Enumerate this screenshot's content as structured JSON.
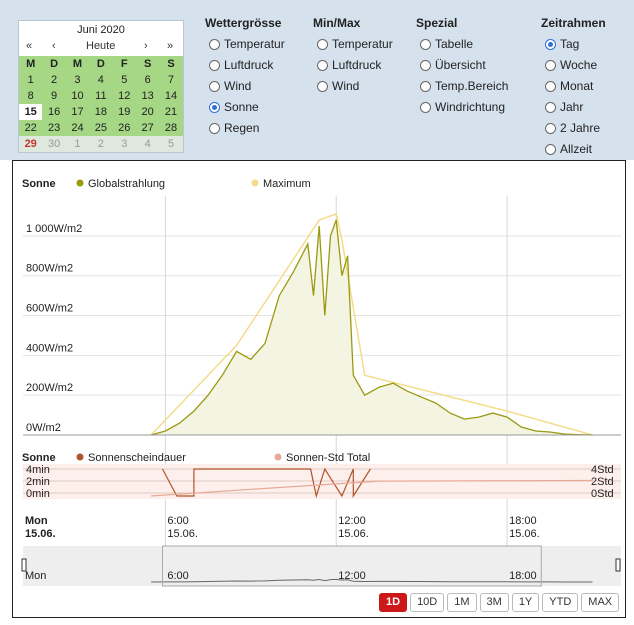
{
  "calendar": {
    "month": "Juni 2020",
    "nav": [
      "«",
      "‹",
      "Heute",
      "›",
      "»"
    ],
    "weekdays": [
      "M",
      "D",
      "M",
      "D",
      "F",
      "S",
      "S"
    ],
    "weeks": [
      [
        "1",
        "2",
        "3",
        "4",
        "5",
        "6",
        "7"
      ],
      [
        "8",
        "9",
        "10",
        "11",
        "12",
        "13",
        "14"
      ],
      [
        "15",
        "16",
        "17",
        "18",
        "19",
        "20",
        "21"
      ],
      [
        "22",
        "23",
        "24",
        "25",
        "26",
        "27",
        "28"
      ],
      [
        "29",
        "30",
        "1",
        "2",
        "3",
        "4",
        "5"
      ]
    ]
  },
  "groups": [
    {
      "title": "Wettergrösse",
      "options": [
        "Temperatur",
        "Luftdruck",
        "Wind",
        "Sonne",
        "Regen"
      ],
      "selected": 3
    },
    {
      "title": "Min/Max",
      "options": [
        "Temperatur",
        "Luftdruck",
        "Wind"
      ],
      "selected": -1
    },
    {
      "title": "Spezial",
      "options": [
        "Tabelle",
        "Übersicht",
        "Temp.Bereich",
        "Windrichtung"
      ],
      "selected": -1
    },
    {
      "title": "Zeitrahmen",
      "options": [
        "Tag",
        "Woche",
        "Monat",
        "Jahr",
        "2 Jahre",
        "Allzeit"
      ],
      "selected": 0
    }
  ],
  "chart_top": {
    "title": "Sonne",
    "legend": [
      "Globalstrahlung",
      "Maximum"
    ],
    "colors": {
      "global": "#9a9a10",
      "max": "#f3dc8a",
      "fill": "#f4f4e2"
    },
    "y_ticks": [
      "0W/m2",
      "200W/m2",
      "400W/m2",
      "600W/m2",
      "800W/m2",
      "1 000W/m2"
    ]
  },
  "chart_bottom": {
    "title": "Sonne",
    "legend": [
      "Sonnenscheindauer",
      "Sonnen-Std Total"
    ],
    "colors": {
      "duration": "#b0532a",
      "total": "#e7a996"
    },
    "left_ticks": [
      "4min",
      "2min",
      "0min"
    ],
    "right_ticks": [
      "4Std",
      "2Std",
      "0Std"
    ]
  },
  "x_axis": {
    "day_label": [
      "Mon",
      "15.06."
    ],
    "ticks": [
      [
        "6:00",
        "15.06."
      ],
      [
        "12:00",
        "15.06."
      ],
      [
        "18:00",
        "15.06."
      ]
    ]
  },
  "navigator": {
    "labels": [
      "Mon",
      "6:00",
      "12:00",
      "18:00"
    ]
  },
  "range_buttons": [
    "1D",
    "10D",
    "1M",
    "3M",
    "1Y",
    "YTD",
    "MAX"
  ],
  "chart_data": {
    "type": "area",
    "x_unit": "hour",
    "series": [
      {
        "name": "Globalstrahlung",
        "x": [
          5.5,
          6,
          6.5,
          7,
          7.5,
          8,
          8.5,
          9,
          9.5,
          10,
          10.5,
          11,
          11.2,
          11.4,
          11.6,
          11.8,
          12,
          12.2,
          12.4,
          12.6,
          13,
          13.5,
          14,
          14.5,
          15,
          15.5,
          16,
          16.5,
          17,
          17.5,
          18,
          18.5,
          19,
          19.5,
          20,
          20.5,
          21
        ],
        "values": [
          0,
          20,
          60,
          120,
          200,
          300,
          420,
          380,
          460,
          700,
          820,
          960,
          700,
          1050,
          600,
          1000,
          1080,
          800,
          900,
          300,
          200,
          240,
          260,
          220,
          190,
          160,
          110,
          80,
          90,
          110,
          90,
          40,
          20,
          15,
          5,
          2,
          0
        ]
      },
      {
        "name": "Maximum",
        "x": [
          5.5,
          8.5,
          11.4,
          12,
          12.2,
          13,
          18,
          21
        ],
        "values": [
          0,
          450,
          1080,
          1110,
          980,
          300,
          120,
          0
        ]
      }
    ],
    "duration": {
      "name": "Sonnenscheindauer",
      "x": [
        5.9,
        6.4,
        6.4,
        7,
        7,
        11.1,
        11.3,
        11.6,
        12.2,
        12.6,
        12.6,
        13.2
      ],
      "values": [
        4,
        0,
        0,
        0,
        4,
        4,
        0,
        4,
        0,
        4,
        0,
        4
      ]
    },
    "total": {
      "name": "Sonnen-Std Total",
      "x": [
        5.5,
        9,
        12,
        13.5,
        21
      ],
      "values": [
        0,
        1.0,
        1.8,
        2.2,
        2.3
      ]
    },
    "ylim": [
      0,
      1100
    ]
  }
}
